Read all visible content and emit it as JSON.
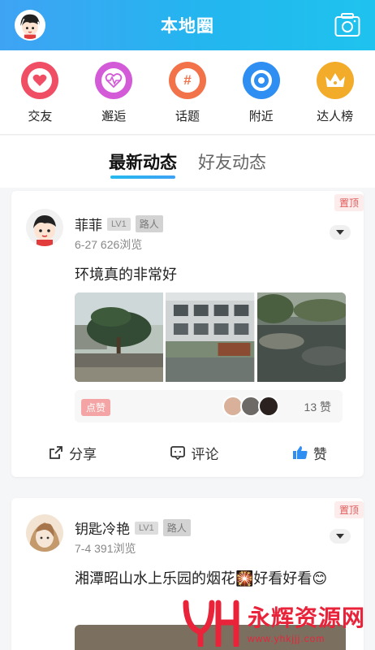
{
  "header": {
    "title": "本地圈"
  },
  "categories": [
    {
      "label": "交友",
      "icon": "heart-icon",
      "color": "#f04e64"
    },
    {
      "label": "邂逅",
      "icon": "heartbeat-icon",
      "color": "#d35bd8"
    },
    {
      "label": "话题",
      "icon": "hashtag-icon",
      "color": "#f2724a"
    },
    {
      "label": "附近",
      "icon": "location-icon",
      "color": "#2f8ef2"
    },
    {
      "label": "达人榜",
      "icon": "crown-icon",
      "color": "#f3ab2a"
    }
  ],
  "tabs": [
    {
      "label": "最新动态",
      "active": true
    },
    {
      "label": "好友动态",
      "active": false
    }
  ],
  "posts": [
    {
      "pin_label": "置顶",
      "name": "菲菲",
      "level": "LV1",
      "role": "路人",
      "date": "6-27",
      "views": "626浏览",
      "text": "环境真的非常好",
      "like_button": "点赞",
      "like_count": "13 赞",
      "actions": {
        "share": "分享",
        "comment": "评论",
        "like": "赞"
      }
    },
    {
      "pin_label": "置顶",
      "name": "钥匙冷艳",
      "level": "LV1",
      "role": "路人",
      "date": "7-4",
      "views": "391浏览",
      "text": "湘潭昭山水上乐园的烟花🎇好看好看😊"
    }
  ],
  "watermark": {
    "title": "永辉资源网",
    "url": "www.yhkjjj.com"
  },
  "colors": {
    "brand_gradient_start": "#3fa3f4",
    "brand_gradient_end": "#1fc3ee",
    "pin_text": "#e05a5a",
    "like_blue": "#2f8ef2"
  }
}
